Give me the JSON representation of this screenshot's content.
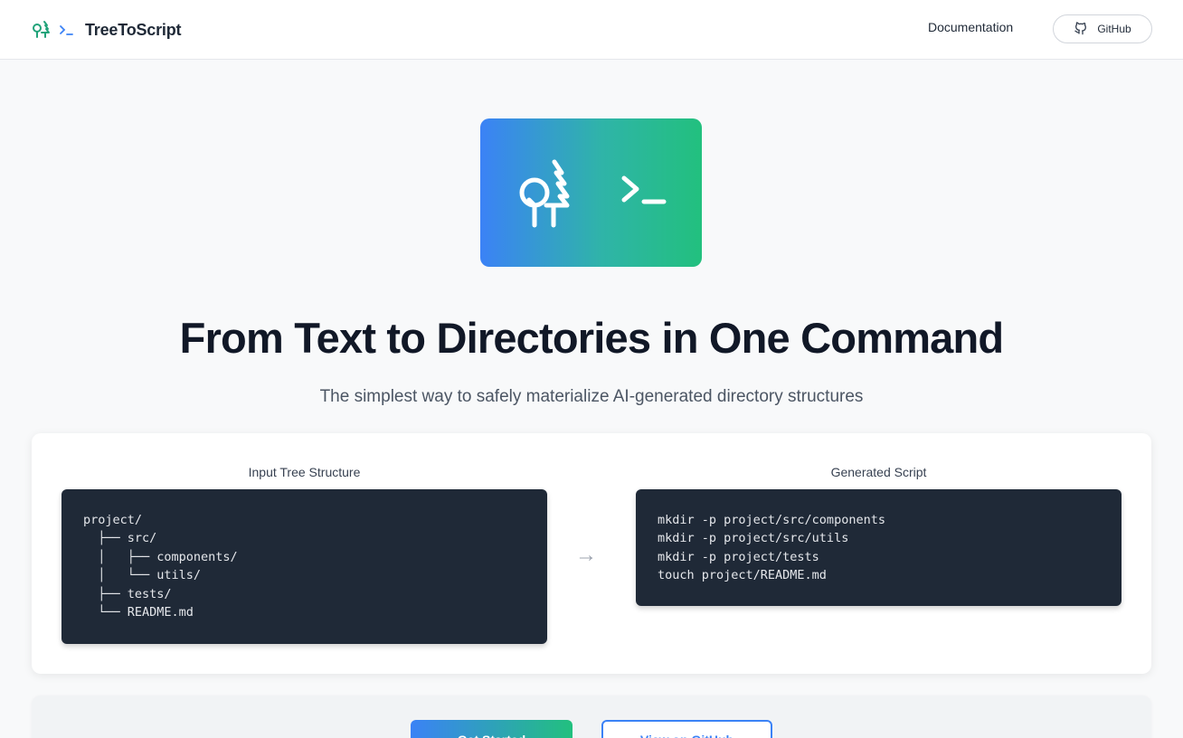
{
  "header": {
    "brand_name": "TreeToScript",
    "nav_documentation": "Documentation",
    "nav_github": "GitHub"
  },
  "hero": {
    "title": "From Text to Directories in One Command",
    "subtitle": "The simplest way to safely materialize AI-generated directory structures"
  },
  "demo": {
    "input_label": "Input Tree Structure",
    "output_label": "Generated Script",
    "arrow": "→",
    "input_lines": [
      "project/",
      "  ├── src/",
      "  │   ├── components/",
      "  │   └── utils/",
      "  ├── tests/",
      "  └── README.md"
    ],
    "output_lines": [
      "mkdir -p project/src/components",
      "mkdir -p project/src/utils",
      "mkdir -p project/tests",
      "touch project/README.md"
    ]
  },
  "cta": {
    "primary_label": "Get Started",
    "secondary_label": "View on GitHub"
  },
  "colors": {
    "gradient_start": "#3b82f6",
    "gradient_end": "#22c07e",
    "code_bg": "#1f2937"
  },
  "icons": [
    "tree-icon",
    "terminal-prompt-icon",
    "github-icon",
    "arrow-right-icon"
  ]
}
